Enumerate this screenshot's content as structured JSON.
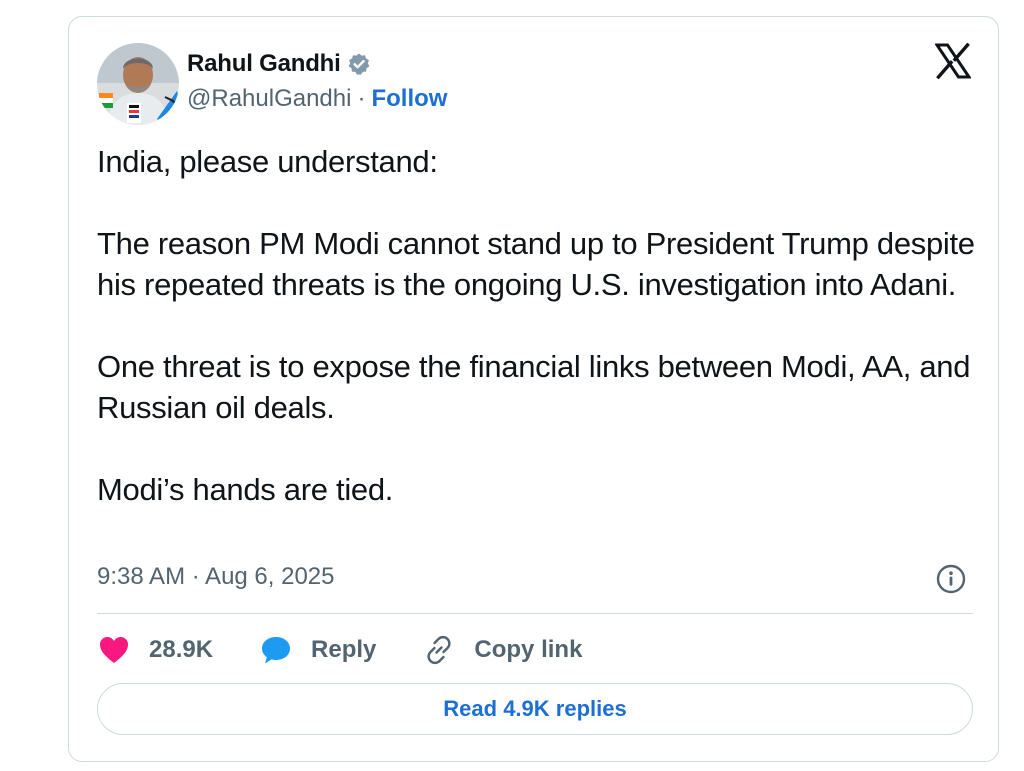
{
  "author": {
    "name": "Rahul Gandhi",
    "handle": "@RahulGandhi",
    "separator": "·",
    "follow_label": "Follow",
    "verified_color": "#829aab"
  },
  "tweet": {
    "paragraphs": [
      "India, please understand:",
      "The reason PM Modi cannot stand up to President Trump despite his repeated threats is the ongoing U.S. investigation into Adani.",
      "One threat is to expose the financial links between Modi, AA, and Russian oil deals.",
      "Modi’s hands are tied."
    ],
    "timestamp": "9:38 AM · Aug 6, 2025"
  },
  "actions": {
    "like_count": "28.9K",
    "reply_label": "Reply",
    "copy_link_label": "Copy link",
    "read_replies_label": "Read 4.9K replies"
  },
  "colors": {
    "accent": "#1d6fd3",
    "heart": "#f91880",
    "reply_bubble": "#1d9bf0",
    "muted": "#536471",
    "border": "#cfd9de"
  },
  "icons": {
    "brand": "x-logo-icon",
    "verified": "verified-badge-icon",
    "info": "info-icon",
    "like": "heart-icon",
    "reply": "reply-bubble-icon",
    "copy": "link-icon"
  }
}
